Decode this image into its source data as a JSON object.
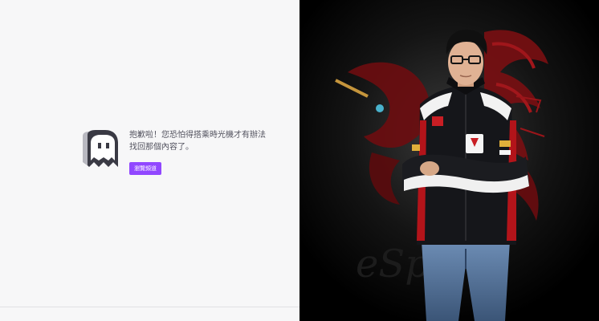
{
  "error_page": {
    "message": "抱歉啦！您恐怕得搭乘時光機才有辦法找回那個內容了。",
    "browse_button_label": "瀏覽頻道"
  },
  "icons": {
    "ghost": "ghost-icon"
  },
  "colors": {
    "accent": "#9147ff",
    "background_left": "#f7f7f8",
    "text": "#53535f",
    "background_right": "#000000"
  },
  "hero_image": {
    "watermark_text": "eSports"
  }
}
